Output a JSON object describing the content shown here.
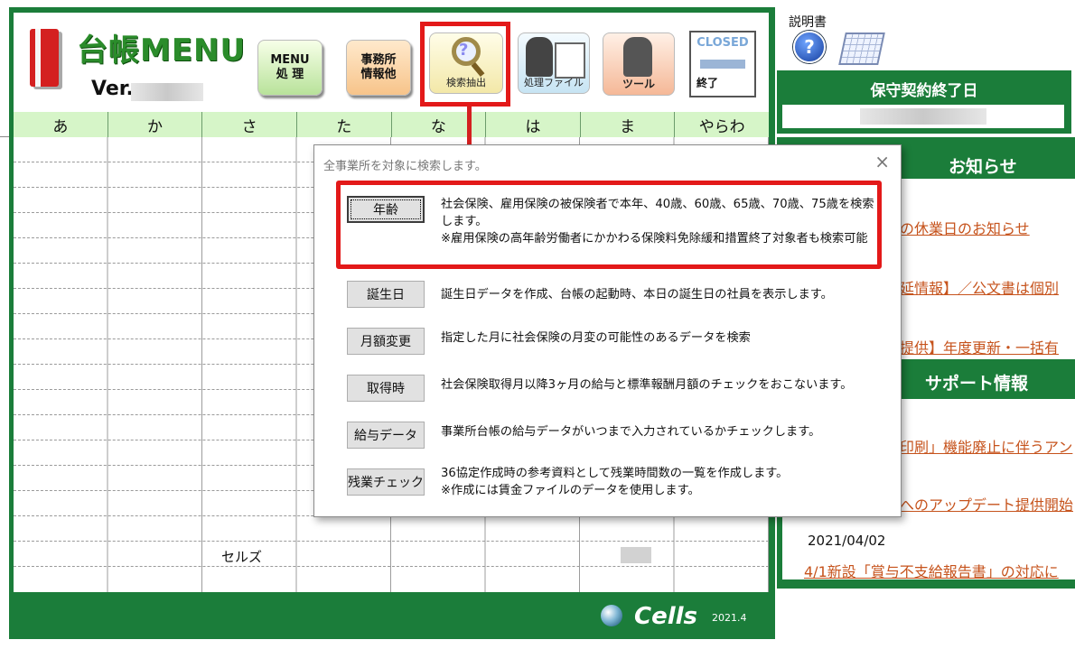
{
  "app": {
    "title": "台帳MENU",
    "version_label": "Ver."
  },
  "toolbar": {
    "menu_label_line1": "MENU",
    "menu_label_line2": "処 理",
    "office_label_line1": "事務所",
    "office_label_line2": "情報他",
    "search_label": "検索抽出",
    "process_file_label": "処理ファイル",
    "tool_label": "ツール",
    "closed_title": "CLOSED",
    "exit_label": "終了"
  },
  "tabs": [
    "あ",
    "か",
    "さ",
    "た",
    "な",
    "は",
    "ま",
    "やらわ"
  ],
  "grid": {
    "cell_name": "セルズ"
  },
  "footer": {
    "brand": "Cells",
    "version": "2021.4"
  },
  "sidebar": {
    "manual_label": "説明書",
    "contract_header": "保守契約終了日",
    "notice_title": "お知らせ",
    "support_title": "サポート情報",
    "notice_links": [
      "の休業日のお知らせ",
      "延情報】／公文書は個別",
      "提供】年度更新・一括有"
    ],
    "support_links": [
      "印刷」機能廃止に伴うアン",
      "へのアップデート提供開始"
    ],
    "support_date": "2021/04/02",
    "support_last_link": "4/1新設「賞与不支給報告書」の対応に"
  },
  "dialog": {
    "title": "全事業所を対象に検索します。",
    "close_glyph": "×",
    "rows": [
      {
        "button": "年齢",
        "desc": "社会保険、雇用保険の被保険者で本年、40歳、60歳、65歳、70歳、75歳を検索します。\n※雇用保険の高年齢労働者にかかわる保険料免除緩和措置終了対象者も検索可能"
      },
      {
        "button": "誕生日",
        "desc": "誕生日データを作成、台帳の起動時、本日の誕生日の社員を表示します。"
      },
      {
        "button": "月額変更",
        "desc": "指定した月に社会保険の月変の可能性のあるデータを検索"
      },
      {
        "button": "取得時",
        "desc": "社会保険取得月以降3ヶ月の給与と標準報酬月額のチェックをおこないます。"
      },
      {
        "button": "給与データ",
        "desc": "事業所台帳の給与データがいつまで入力されているかチェックします。"
      },
      {
        "button": "残業チェック",
        "desc": "36協定作成時の参考資料として残業時間数の一覧を作成します。\n※作成には賃金ファイルのデータを使用します。"
      }
    ]
  },
  "colors": {
    "frame_green": "#1b7d3a",
    "highlight_red": "#e31919",
    "tab_green": "#d6f5c8",
    "link_orange": "#c6531c"
  },
  "icons": [
    "ledger-book-icon",
    "magnifier-icon",
    "process-file-icon",
    "tool-icon",
    "closed-exit-icon",
    "help-icon",
    "calendar-icon",
    "close-icon",
    "globe-icon",
    "arrow-down-icon"
  ]
}
